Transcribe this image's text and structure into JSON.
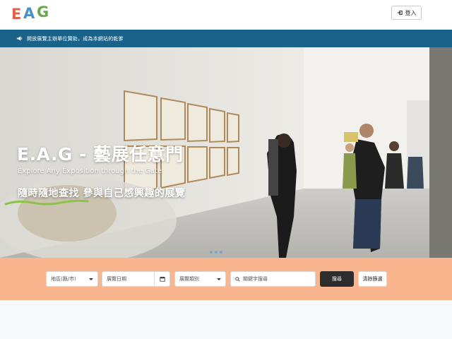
{
  "header": {
    "logo": {
      "letters": [
        "E",
        "A",
        "G"
      ],
      "colors": [
        "#e0624a",
        "#4a90c8",
        "#6aa84f"
      ]
    },
    "login_label": "登入",
    "login_icon": "sign-in-icon"
  },
  "announcement": {
    "icon": "megaphone-icon",
    "text": "開放展覽主辦單位贊助，成為本網站的乾爹"
  },
  "hero": {
    "title": "E.A.G - 藝展任意門",
    "subtitle": "Explore Any Exposition through the Gate",
    "tagline_highlight": "隨時隨地查找",
    "tagline_rest": " 參與自己感興趣的展覽",
    "carousel_slides": 3,
    "accent_color": "#8bc34a"
  },
  "search": {
    "city_placeholder": "地區(縣/市)",
    "date_placeholder": "展覽日期",
    "category_placeholder": "展覽類別",
    "keyword_placeholder": "關鍵字搜尋",
    "search_label": "搜尋",
    "clear_label": "清除篩選"
  },
  "colors": {
    "announcement_bg": "#19628a",
    "search_band_bg": "#f8b58e",
    "search_button_bg": "#2d2d2d"
  }
}
